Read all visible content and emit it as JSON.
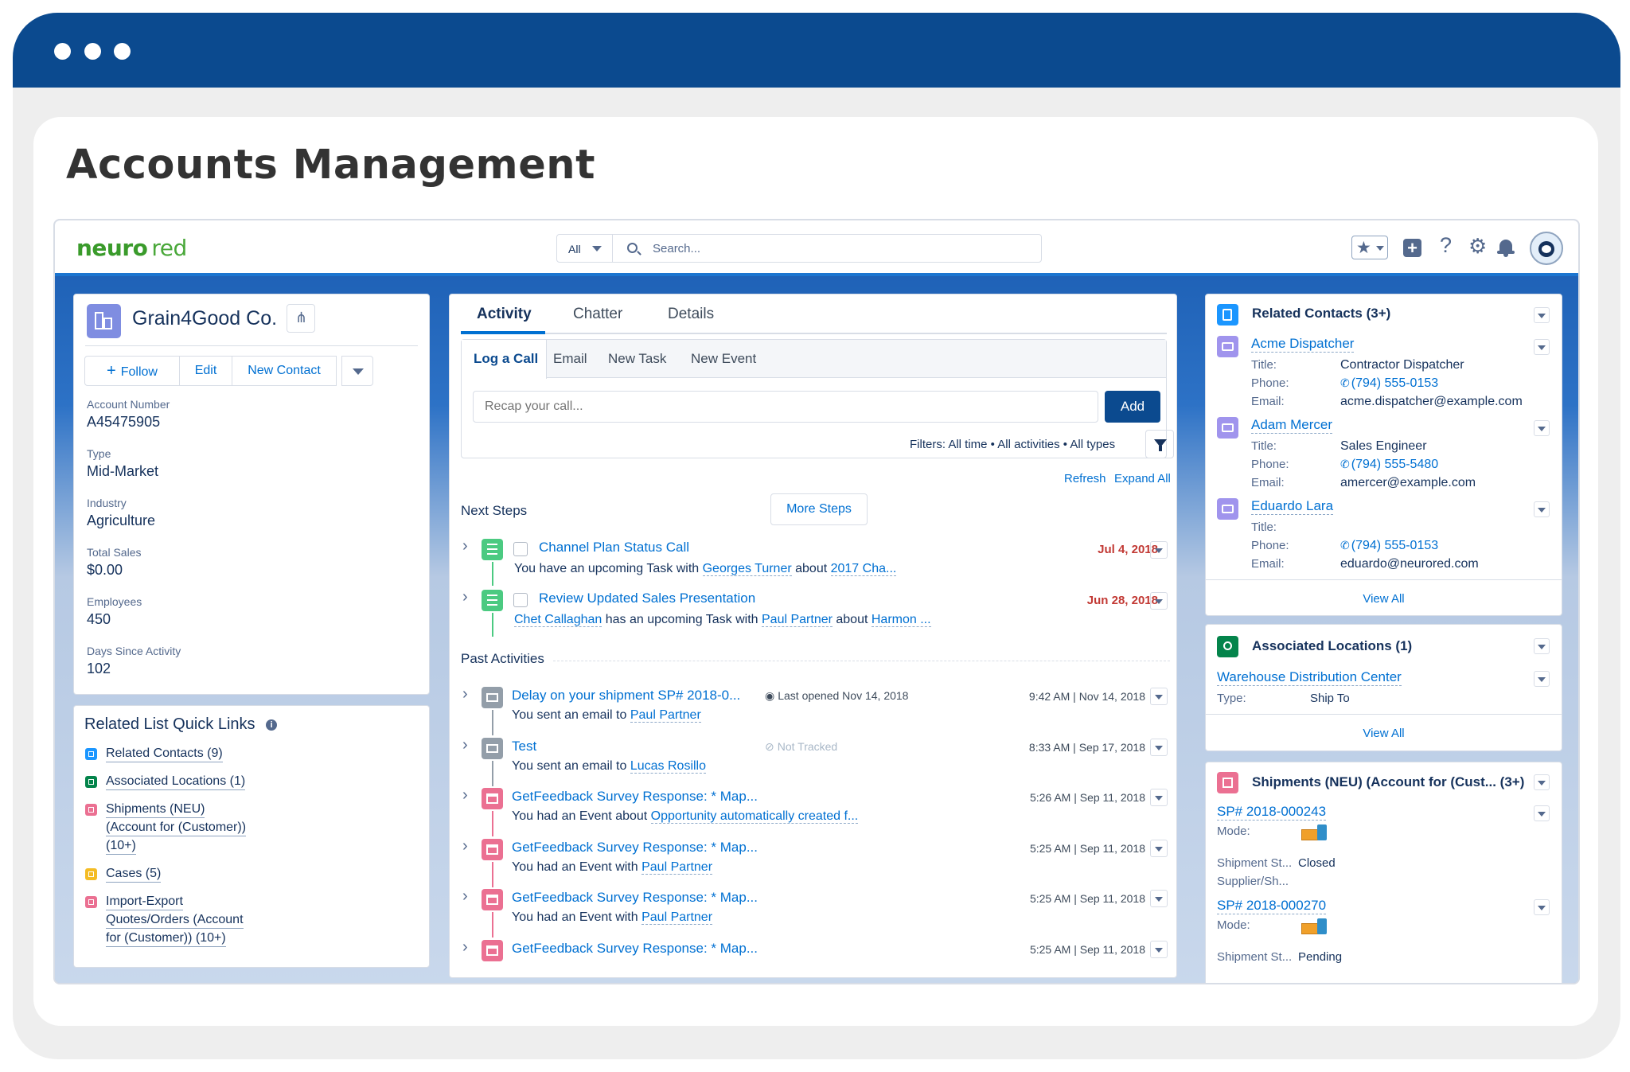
{
  "page": {
    "title": "Accounts Management"
  },
  "topbar": {
    "logo_part1": "neuro",
    "logo_part2": "red",
    "scope": "All",
    "search_placeholder": "Search..."
  },
  "colors": {
    "brand": "#0b4a8f",
    "link": "#0070d2",
    "task": "#4bca81",
    "email": "#939ea9",
    "event": "#eb7092",
    "due": "#c23934"
  },
  "account": {
    "name": "Grain4Good Co.",
    "actions": {
      "follow": "Follow",
      "edit": "Edit",
      "new_contact": "New Contact"
    },
    "fields": [
      {
        "label": "Account Number",
        "value": "A45475905"
      },
      {
        "label": "Type",
        "value": "Mid-Market"
      },
      {
        "label": "Industry",
        "value": "Agriculture"
      },
      {
        "label": "Total Sales",
        "value": "$0.00"
      },
      {
        "label": "Employees",
        "value": "450"
      },
      {
        "label": "Days Since Activity",
        "value": "102"
      }
    ]
  },
  "quick_links": {
    "title": "Related List Quick Links",
    "items": [
      {
        "lines": [
          "Related Contacts (9)"
        ],
        "color": "#1b96ff"
      },
      {
        "lines": [
          "Associated Locations (1)"
        ],
        "color": "#04844b"
      },
      {
        "lines": [
          "Shipments (NEU)",
          "(Account for (Customer))",
          "(10+)"
        ],
        "color": "#eb7092"
      },
      {
        "lines": [
          "Cases (5)"
        ],
        "color": "#f4bc25"
      },
      {
        "lines": [
          "Import-Export",
          "Quotes/Orders (Account",
          "for (Customer)) (10+)"
        ],
        "color": "#eb7092"
      }
    ]
  },
  "activity": {
    "tabs": [
      "Activity",
      "Chatter",
      "Details"
    ],
    "subtabs": [
      "Log a Call",
      "Email",
      "New Task",
      "New Event"
    ],
    "composer_placeholder": "Recap your call...",
    "add_label": "Add",
    "filters": "Filters: All time • All activities • All types",
    "refresh": "Refresh",
    "expand_all": "Expand All",
    "next_steps_title": "Next Steps",
    "more_steps": "More Steps",
    "next_steps": [
      {
        "title": "Channel Plan Status Call",
        "date": "Jul 4, 2018",
        "p1": "You have an upcoming Task with ",
        "link1": "Georges Turner",
        "p2": " about ",
        "link2": "2017 Cha..."
      },
      {
        "title": "Review Updated Sales Presentation",
        "date": "Jun 28, 2018",
        "link0": "Chet Callaghan",
        "p1": " has an upcoming Task with ",
        "link1": "Paul Partner",
        "p2": " about ",
        "link2": "Harmon ..."
      }
    ],
    "past_title": "Past Activities",
    "past": [
      {
        "type": "email",
        "title": "Delay on your shipment SP# 2018-0...",
        "meta": "Last opened Nov 14, 2018",
        "date": "9:42 AM | Nov 14, 2018",
        "p1": "You sent an email to ",
        "link1": "Paul Partner"
      },
      {
        "type": "email",
        "title": "Test",
        "meta": "Not Tracked",
        "date": "8:33 AM | Sep 17, 2018",
        "p1": "You sent an email to ",
        "link1": "Lucas Rosillo"
      },
      {
        "type": "event",
        "title": "GetFeedback Survey Response: * Map...",
        "meta": "",
        "date": "5:26 AM | Sep 11, 2018",
        "p1": "You had an Event about ",
        "link1": "Opportunity automatically created f..."
      },
      {
        "type": "event",
        "title": "GetFeedback Survey Response: * Map...",
        "meta": "",
        "date": "5:25 AM | Sep 11, 2018",
        "p1": "You had an Event with ",
        "link1": "Paul Partner"
      },
      {
        "type": "event",
        "title": "GetFeedback Survey Response: * Map...",
        "meta": "",
        "date": "5:25 AM | Sep 11, 2018",
        "p1": "You had an Event with ",
        "link1": "Paul Partner"
      },
      {
        "type": "event",
        "title": "GetFeedback Survey Response: * Map...",
        "meta": "",
        "date": "5:25 AM | Sep 11, 2018",
        "p1": "",
        "link1": ""
      }
    ]
  },
  "related_contacts": {
    "title": "Related Contacts (3+)",
    "labels": {
      "title": "Title:",
      "phone": "Phone:",
      "email": "Email:"
    },
    "view_all": "View All",
    "items": [
      {
        "name": "Acme Dispatcher",
        "title": "Contractor Dispatcher",
        "phone": "(794) 555-0153",
        "email": "acme.dispatcher@example.com"
      },
      {
        "name": "Adam Mercer",
        "title": "Sales Engineer",
        "phone": "(794) 555-5480",
        "email": "amercer@example.com"
      },
      {
        "name": "Eduardo Lara",
        "title": "",
        "phone": "(794) 555-0153",
        "email": "eduardo@neurored.com"
      }
    ]
  },
  "locations": {
    "title": "Associated Locations (1)",
    "name": "Warehouse Distribution Center",
    "type_label": "Type:",
    "type_value": "Ship To",
    "view_all": "View All"
  },
  "shipments": {
    "title": "Shipments (NEU) (Account for (Cust... (3+)",
    "items": [
      {
        "id": "SP# 2018-000243",
        "mode_label": "Mode:",
        "status_label": "Shipment St...",
        "status": "Closed",
        "supplier_label": "Supplier/Sh..."
      },
      {
        "id": "SP# 2018-000270",
        "mode_label": "Mode:",
        "status_label": "Shipment St...",
        "status": "Pending",
        "supplier_label": ""
      }
    ]
  }
}
